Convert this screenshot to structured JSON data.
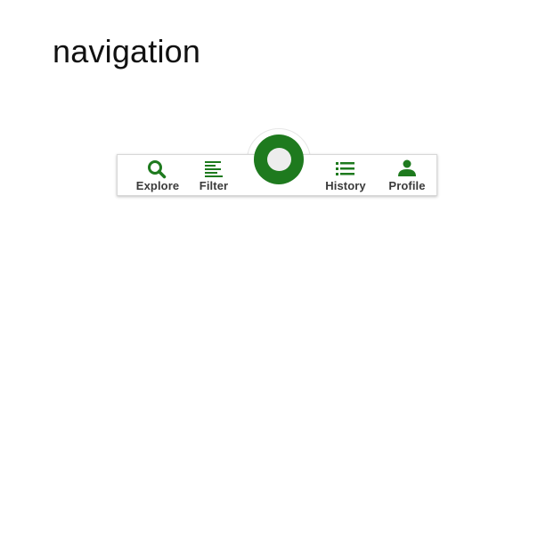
{
  "page": {
    "title": "navigation"
  },
  "navbar": {
    "items": [
      {
        "label": "Explore",
        "icon": "search-icon"
      },
      {
        "label": "Filter",
        "icon": "filter-lines-icon"
      },
      {
        "label": "History",
        "icon": "list-icon"
      },
      {
        "label": "Profile",
        "icon": "person-icon"
      }
    ],
    "center_button": {
      "icon": "circle-icon"
    }
  },
  "colors": {
    "accent": "#1e7a1e",
    "label": "#3b3b3b",
    "fab_inner": "#ededed"
  }
}
